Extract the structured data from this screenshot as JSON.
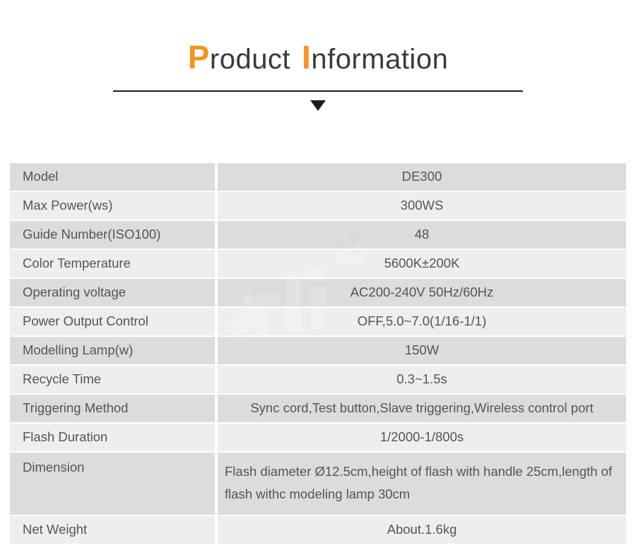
{
  "header": {
    "title_word1_cap": "P",
    "title_word1_rest": "roduct",
    "title_word2_cap": "I",
    "title_word2_rest": "nformation",
    "accent_color": "#f7931e",
    "text_color": "#3a3a3a",
    "rule_color": "#1c1c1c",
    "arrow_icon": "triangle-down-icon"
  },
  "table": {
    "shade_dark": "#dcdcdc",
    "shade_light": "#eeeeee",
    "text_color": "#555555",
    "rows": [
      {
        "label": "Model",
        "value": "DE300"
      },
      {
        "label": "Max Power(ws)",
        "value": "300WS"
      },
      {
        "label": "Guide Number(ISO100)",
        "value": "48"
      },
      {
        "label": "Color Temperature",
        "value": "5600K±200K"
      },
      {
        "label": "Operating voltage",
        "value": "AC200-240V  50Hz/60Hz"
      },
      {
        "label": "Power Output Control",
        "value": "OFF,5.0~7.0(1/16-1/1)"
      },
      {
        "label": "Modelling Lamp(w)",
        "value": "150W"
      },
      {
        "label": "Recycle Time",
        "value": "0.3~1.5s"
      },
      {
        "label": "Triggering Method",
        "value": "Sync cord,Test button,Slave triggering,Wireless control port"
      },
      {
        "label": "Flash Duration",
        "value": "1/2000-1/800s"
      },
      {
        "label": "Dimension",
        "value": "Flash diameter Ø12.5cm,height of flash with handle 25cm,length of flash withc modeling lamp 30cm"
      },
      {
        "label": "Net Weight",
        "value": "About.1.6kg"
      }
    ]
  }
}
